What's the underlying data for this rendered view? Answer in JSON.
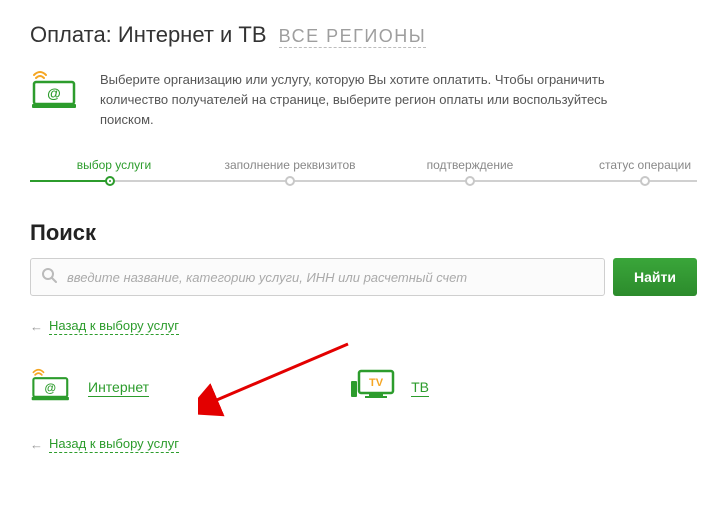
{
  "title": {
    "prefix": "Оплата:",
    "main": "Интернет и ТВ",
    "region": "ВСЕ РЕГИОНЫ"
  },
  "intro_text": "Выберите организацию или услугу, которую Вы хотите оплатить. Чтобы ограничить количество получателей на странице, выберите регион оплаты или воспользуйтесь поиском.",
  "steps": [
    {
      "label": "выбор услуги",
      "active": true
    },
    {
      "label": "заполнение реквизитов",
      "active": false
    },
    {
      "label": "подтверждение",
      "active": false
    },
    {
      "label": "статус операции",
      "active": false
    }
  ],
  "search": {
    "heading": "Поиск",
    "placeholder": "введите название, категорию услуги, ИНН или расчетный счет",
    "button": "Найти"
  },
  "back_link_top": "Назад к выбору услуг",
  "back_link_bottom": "Назад к выбору услуг",
  "categories": {
    "internet": "Интернет",
    "tv": "ТВ"
  },
  "colors": {
    "accent": "#2c9c2c",
    "muted": "#9e9e9e"
  }
}
